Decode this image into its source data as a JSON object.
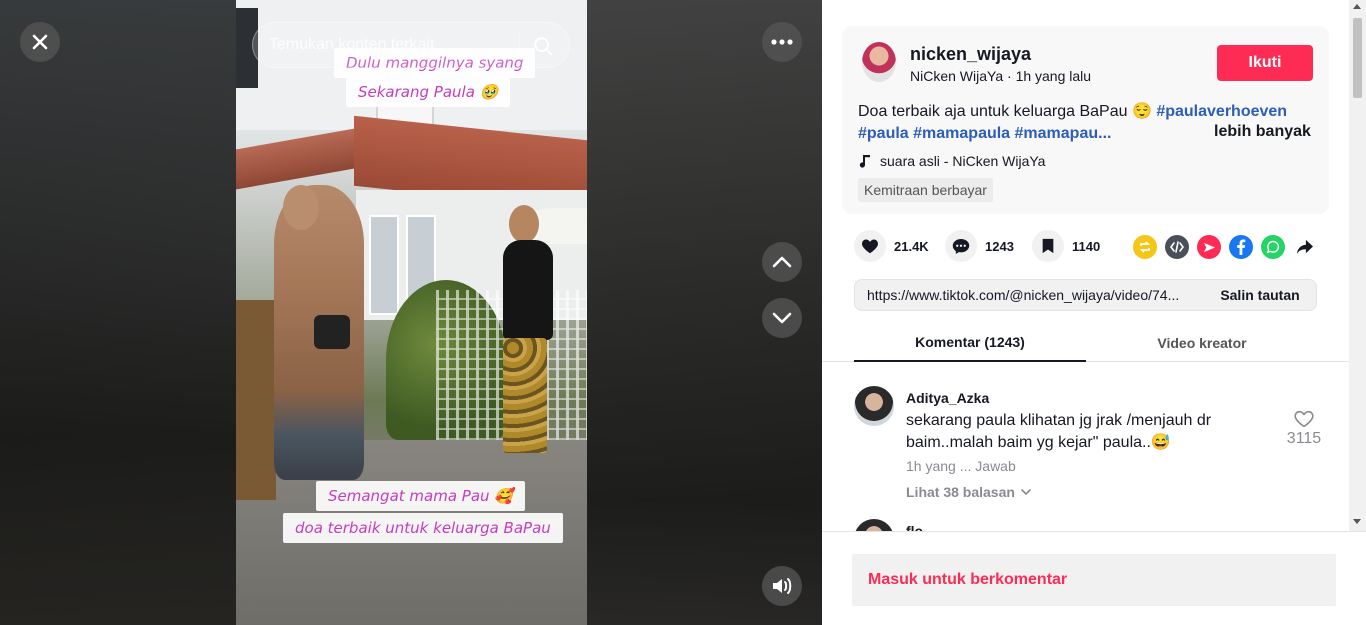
{
  "video": {
    "search": {
      "placeholder": "Temukan konten terkait"
    },
    "captions": [
      "Dulu manggilnya syang",
      "Sekarang Paula 🥹",
      "Semangat mama Pau 🥰",
      "doa terbaik untuk keluarga BaPau"
    ]
  },
  "post": {
    "username": "nicken_wijaya",
    "display_name": "NiCken WijaYa",
    "separator": " · ",
    "time": "1h yang lalu",
    "follow_label": "Ikuti",
    "description_text": "Doa terbaik aja untuk keluarga BaPau 😌 ",
    "hashtags": [
      "#paulaverhoeven",
      "#paula",
      "#mamapaula",
      "#mamapau..."
    ],
    "more_label": "lebih banyak",
    "music": "suara asli - NiCken WijaYa",
    "paid_label": "Kemitraan berbayar"
  },
  "actions": {
    "likes": "21.4K",
    "comments": "1243",
    "saves": "1140"
  },
  "link": {
    "url": "https://www.tiktok.com/@nicken_wijaya/video/74...",
    "copy_label": "Salin tautan"
  },
  "tabs": [
    {
      "label": "Komentar (1243)",
      "active": true
    },
    {
      "label": "Video kreator",
      "active": false
    }
  ],
  "comments": [
    {
      "name": "Aditya_Azka",
      "text": "sekarang paula klihatan jg jrak /menjauh dr baim..malah baim yg kejar\" paula..😅",
      "time": "1h yang ...",
      "reply_label": "Jawab",
      "view_replies": "Lihat 38 balasan",
      "likes": "3115"
    },
    {
      "name": "flo"
    }
  ],
  "bottom": {
    "login_label": "Masuk untuk berkomentar"
  },
  "colors": {
    "accent": "#fe2c55",
    "hashtag": "#2b5db9",
    "text": "#161823",
    "muted": "#8a8b91"
  }
}
